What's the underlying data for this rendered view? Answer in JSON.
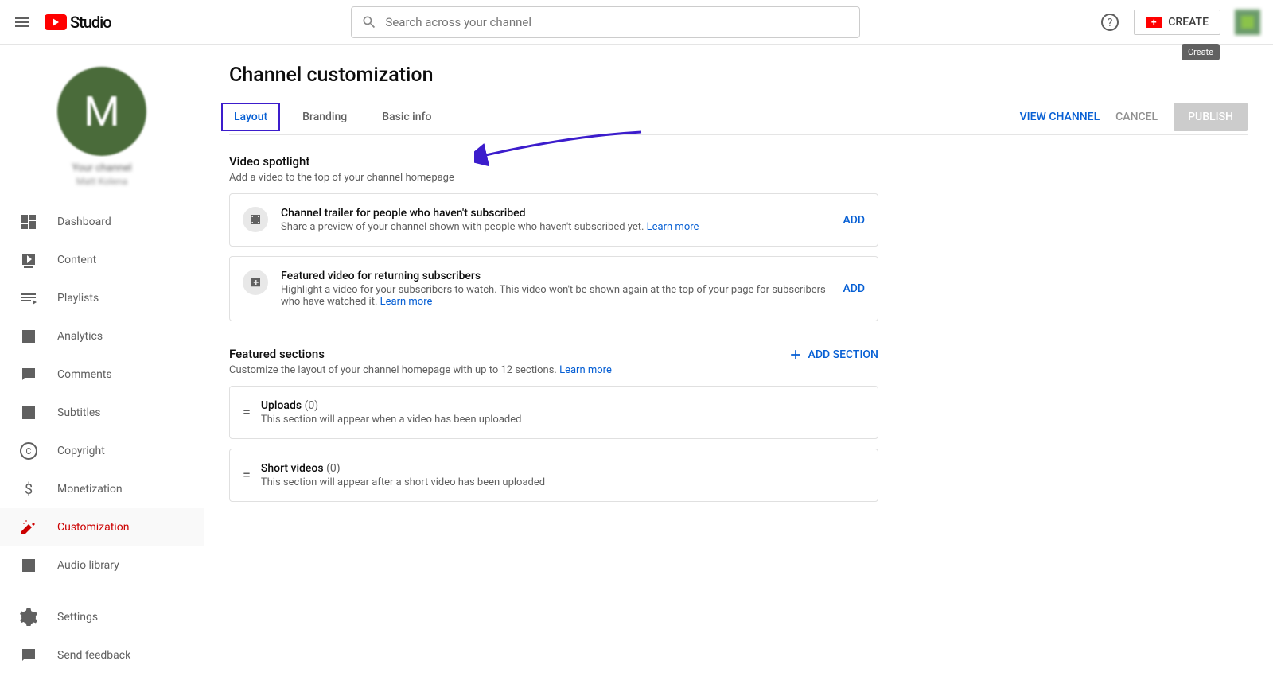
{
  "header": {
    "logo_text": "Studio",
    "search_placeholder": "Search across your channel",
    "create_label": "CREATE",
    "create_tooltip": "Create"
  },
  "sidebar": {
    "avatar_letter": "M",
    "channel_label": "Your channel",
    "channel_name": "Matt Kolena",
    "items": [
      {
        "label": "Dashboard"
      },
      {
        "label": "Content"
      },
      {
        "label": "Playlists"
      },
      {
        "label": "Analytics"
      },
      {
        "label": "Comments"
      },
      {
        "label": "Subtitles"
      },
      {
        "label": "Copyright"
      },
      {
        "label": "Monetization"
      },
      {
        "label": "Customization"
      },
      {
        "label": "Audio library"
      }
    ],
    "bottom": [
      {
        "label": "Settings"
      },
      {
        "label": "Send feedback"
      }
    ]
  },
  "page": {
    "title": "Channel customization",
    "tabs": [
      {
        "label": "Layout",
        "active": true
      },
      {
        "label": "Branding",
        "active": false
      },
      {
        "label": "Basic info",
        "active": false
      }
    ],
    "view_channel": "VIEW CHANNEL",
    "cancel": "CANCEL",
    "publish": "PUBLISH"
  },
  "spotlight": {
    "title": "Video spotlight",
    "subtitle": "Add a video to the top of your channel homepage",
    "cards": [
      {
        "title": "Channel trailer for people who haven't subscribed",
        "desc": "Share a preview of your channel shown with people who haven't subscribed yet.  ",
        "learn_more": "Learn more",
        "action": "ADD"
      },
      {
        "title": "Featured video for returning subscribers",
        "desc": "Highlight a video for your subscribers to watch. This video won't be shown again at the top of your page for subscribers who have watched it.  ",
        "learn_more": "Learn more",
        "action": "ADD"
      }
    ]
  },
  "featured": {
    "title": "Featured sections",
    "subtitle": "Customize the layout of your channel homepage with up to 12 sections. ",
    "learn_more": "Learn more",
    "add_section": "ADD SECTION",
    "items": [
      {
        "label": "Uploads",
        "count": "(0)",
        "desc": "This section will appear when a video has been uploaded"
      },
      {
        "label": "Short videos",
        "count": "(0)",
        "desc": "This section will appear after a short video has been uploaded"
      }
    ]
  }
}
